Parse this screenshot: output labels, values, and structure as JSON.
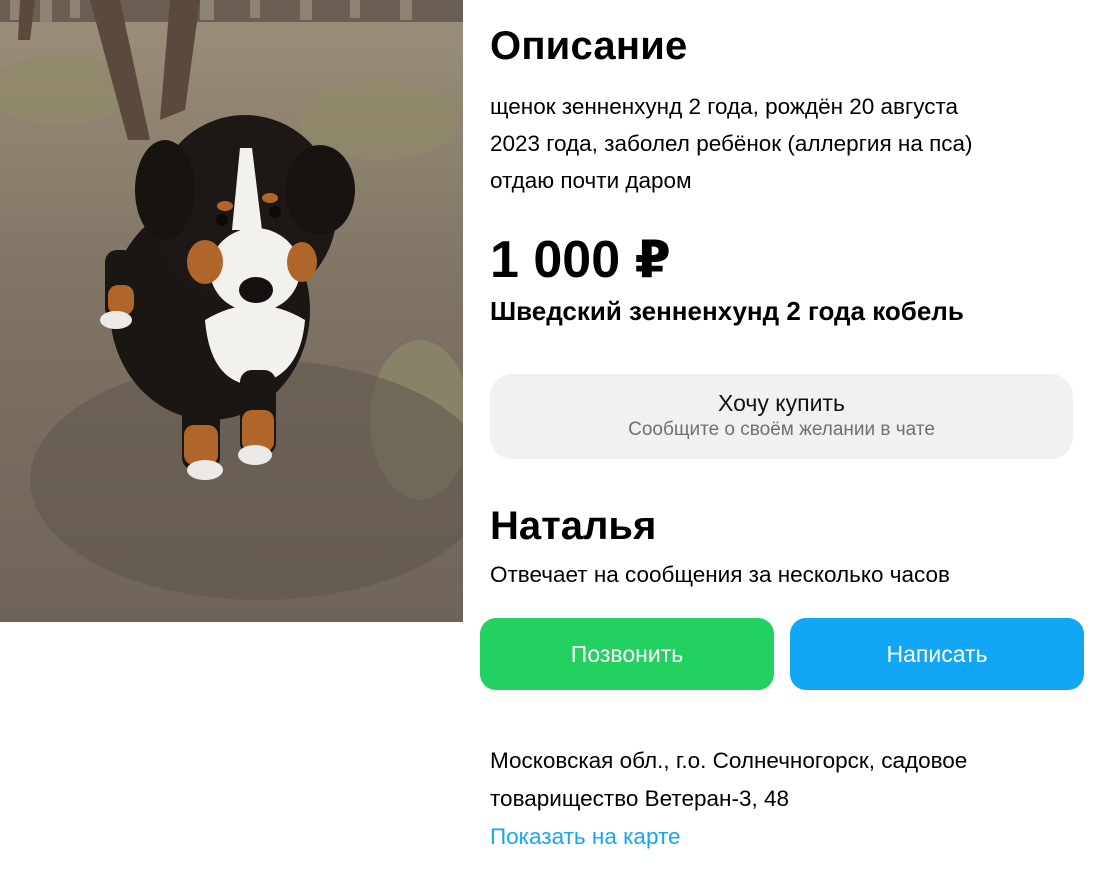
{
  "description": {
    "heading": "Описание",
    "lines": [
      "щенок зенненхунд 2 года, рождён 20 августа",
      "2023 года, заболел ребёнок (аллергия на пса)",
      "отдаю почти даром"
    ]
  },
  "listing": {
    "price": "1 000 ₽",
    "title": "Шведский зенненхунд 2 года кобель"
  },
  "buy": {
    "label": "Хочу купить",
    "sublabel": "Сообщите о своём желании в чате"
  },
  "seller": {
    "name": "Наталья",
    "response_time": "Отвечает на сообщения за несколько часов"
  },
  "actions": {
    "call_label": "Позвонить",
    "write_label": "Написать"
  },
  "location": {
    "lines": [
      "Московская обл., г.о. Солнечногорск, садовое",
      "товарищество Ветеран-3, 48"
    ],
    "map_link": "Показать на карте"
  },
  "colors": {
    "call_button": "#23d160",
    "write_button": "#12a7f5",
    "link": "#12a7f5",
    "buy_button_bg": "#f2f1f0"
  }
}
